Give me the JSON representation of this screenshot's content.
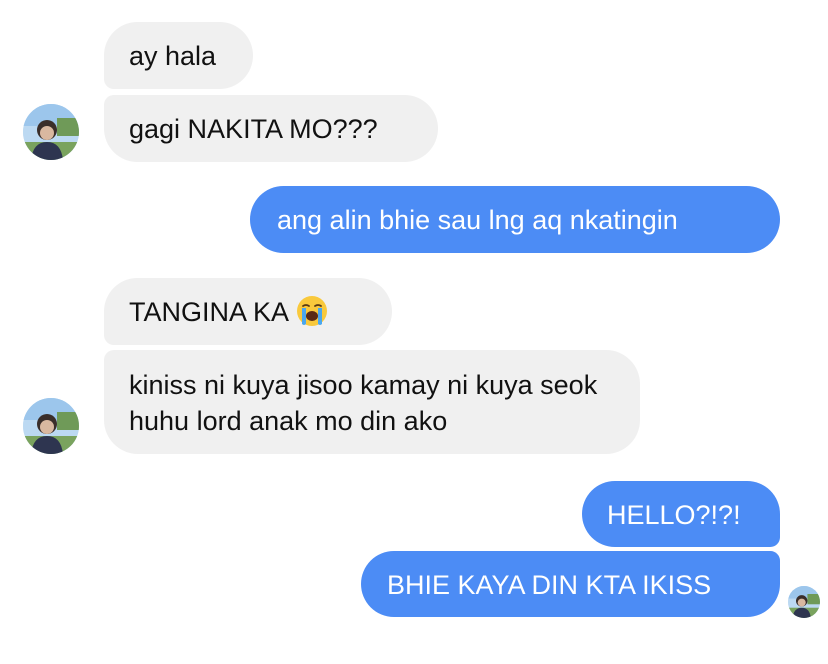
{
  "messages": [
    {
      "id": "m1",
      "side": "incoming",
      "text": "ay hala"
    },
    {
      "id": "m2",
      "side": "incoming",
      "text": "gagi NAKITA MO???"
    },
    {
      "id": "m3",
      "side": "outgoing",
      "text": "ang alin bhie sau lng aq nkatingin"
    },
    {
      "id": "m4",
      "side": "incoming",
      "text": "TANGINA KA",
      "emoji": "loudly-crying-face-emoji"
    },
    {
      "id": "m5",
      "side": "incoming",
      "text": "kiniss ni kuya jisoo kamay ni kuya seok huhu lord anak mo din ako"
    },
    {
      "id": "m6",
      "side": "outgoing",
      "text": "HELLO?!?!"
    },
    {
      "id": "m7",
      "side": "outgoing",
      "text": "BHIE KAYA DIN KTA IKISS"
    }
  ],
  "avatars": [
    {
      "id": "incoming-avatar",
      "icon": "profile-photo-avatar"
    },
    {
      "id": "read-receipt-avatar",
      "icon": "profile-photo-avatar"
    }
  ],
  "colors": {
    "incoming_bubble": "#f0f0f0",
    "outgoing_bubble": "#4c8cf5",
    "incoming_text": "#111111",
    "outgoing_text": "#ffffff"
  }
}
